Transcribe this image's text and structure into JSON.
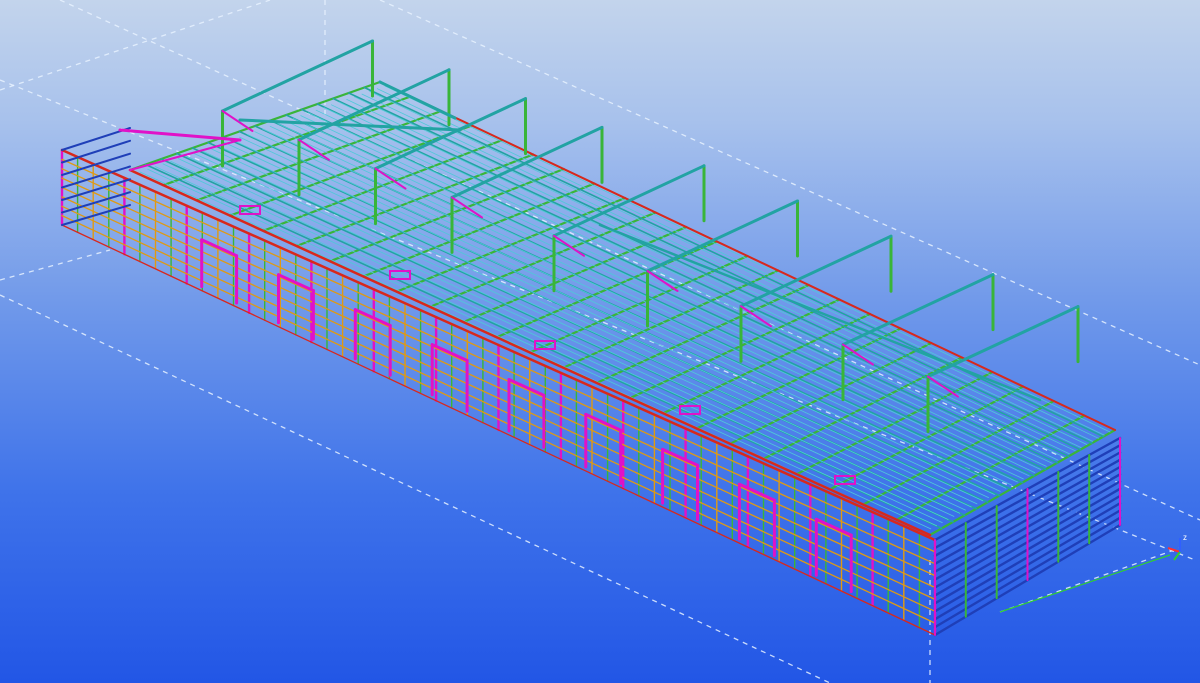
{
  "app": {
    "view": "3D model view"
  },
  "view_triad": {
    "axis_x_label": "",
    "axis_y_label": "",
    "axis_z_label": "z"
  },
  "colors": {
    "background_top": "#c3d4ec",
    "background_bottom": "#2256e6",
    "grid_line": "#e8f2ff",
    "purlin_teal": "#22a3a3",
    "rafter_green": "#39b539",
    "column_magenta": "#e012c8",
    "girt_orange": "#e09a12",
    "eave_red": "#d8281c",
    "wall_blue": "#1f3fb8",
    "axis_red": "#ff3030",
    "axis_green": "#30d030",
    "axis_blue": "#3060ff"
  },
  "icons": {
    "view_triad": "coordinate-axes-icon"
  }
}
